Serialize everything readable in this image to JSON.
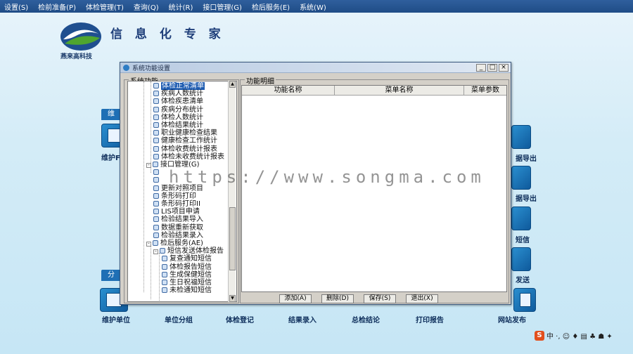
{
  "menu": [
    "设置(S)",
    "检前准备(P)",
    "体检管理(T)",
    "查询(Q)",
    "统计(R)",
    "接口管理(G)",
    "检后服务(E)",
    "系统(W)"
  ],
  "brand": {
    "title": "信 息 化 专 家",
    "logo_text": "燕来高科技"
  },
  "background": {
    "section_tag_top": "维",
    "section_tag_bottom": "分",
    "tile_left_top_label": "维护F",
    "bottom_labels": [
      "维护单位",
      "单位分组",
      "体检登记",
      "结果录入",
      "总检结论",
      "打印报告",
      "网站发布"
    ],
    "right_labels": [
      "据导出",
      "据导出",
      "短信",
      "发送"
    ]
  },
  "dialog": {
    "title": "系统功能设置",
    "btn_min": "_",
    "btn_max": "□",
    "btn_close": "×",
    "left_group": "系统功能",
    "right_group": "功能明细",
    "tree": [
      {
        "text": "体检正常清单",
        "level": 2,
        "sel": true
      },
      {
        "text": "疾病人数统计",
        "level": 2
      },
      {
        "text": "体检疾患清单",
        "level": 2
      },
      {
        "text": "疾病分布统计",
        "level": 2
      },
      {
        "text": "体检人数统计",
        "level": 2
      },
      {
        "text": "体检结果统计",
        "level": 2
      },
      {
        "text": "职业健康检查结果",
        "level": 2
      },
      {
        "text": "健康检查工作统计",
        "level": 2
      },
      {
        "text": "体检收费统计报表",
        "level": 2
      },
      {
        "text": "体检未收费统计报表",
        "level": 2
      },
      {
        "text": "接口管理(G)",
        "level": 1,
        "pm": "-"
      },
      {
        "text": "",
        "level": 2
      },
      {
        "text": "",
        "level": 2
      },
      {
        "text": "更新对照项目",
        "level": 2
      },
      {
        "text": "条形码打印",
        "level": 2
      },
      {
        "text": "条形码打印II",
        "level": 2
      },
      {
        "text": "LIS项目申请",
        "level": 2
      },
      {
        "text": "检验结果导入",
        "level": 2
      },
      {
        "text": "数据重新获取",
        "level": 2
      },
      {
        "text": "检验结果录入",
        "level": 2
      },
      {
        "text": "检后服务(AE)",
        "level": 1,
        "pm": "-"
      },
      {
        "text": "短信发送体检报告",
        "level": 2,
        "pm": "-"
      },
      {
        "text": "复查通知短信",
        "level": 3
      },
      {
        "text": "体检报告短信",
        "level": 3
      },
      {
        "text": "生成保健短信",
        "level": 3
      },
      {
        "text": "生日祝福短信",
        "level": 3
      },
      {
        "text": "未检通知短信",
        "level": 3
      }
    ],
    "columns": [
      "功能名称",
      "菜单名称",
      "菜单参数"
    ],
    "buttons": [
      "添加(A)",
      "删除(D)",
      "保存(S)",
      "退出(X)"
    ]
  },
  "watermark": "https://www.songma.com",
  "tray": {
    "app": "S",
    "icons": "中 ·, ☺ ♦ ▤ ♣ ☗ ✦"
  }
}
